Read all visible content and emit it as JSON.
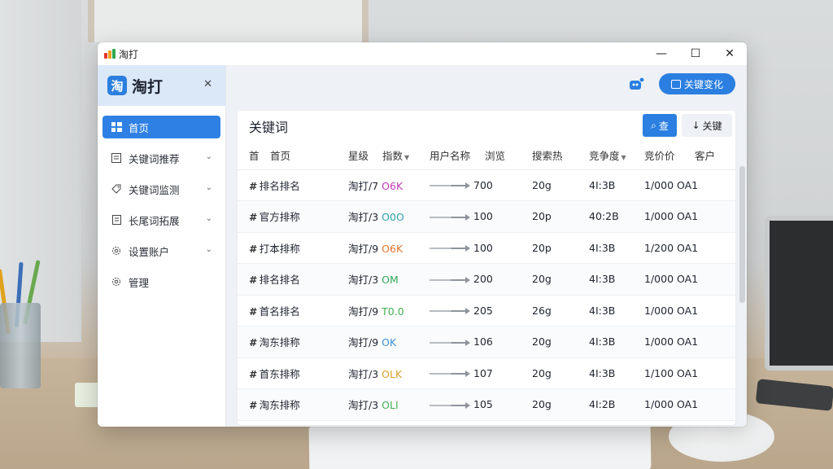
{
  "window": {
    "title": "淘打",
    "controls": {
      "minimize": "—",
      "maximize": "☐",
      "close": "✕"
    }
  },
  "sidebar": {
    "brand": {
      "logo": "淘",
      "name": "淘打",
      "close": "✕"
    },
    "items": [
      {
        "label": "首页",
        "icon": "home-icon",
        "active": true,
        "chevron": false
      },
      {
        "label": "关键词推荐",
        "icon": "list-icon",
        "active": false,
        "chevron": true
      },
      {
        "label": "关键词监测",
        "icon": "tag-icon",
        "active": false,
        "chevron": true
      },
      {
        "label": "长尾词拓展",
        "icon": "document-icon",
        "active": false,
        "chevron": true
      },
      {
        "label": "设置账户",
        "icon": "settings-icon",
        "active": false,
        "chevron": true
      },
      {
        "label": "管理",
        "icon": "gear-icon",
        "active": false,
        "chevron": false
      }
    ]
  },
  "topbar": {
    "notify_icon": "robot-icon",
    "primary_button": "关键变化"
  },
  "panel": {
    "title": "关键词",
    "search_button": "查",
    "filter_button": "关键"
  },
  "table": {
    "headers": [
      "首",
      "首页",
      "星级",
      "指数",
      "用户名称",
      "浏览",
      "搜索热",
      "竞争度",
      "竞价价",
      "客户"
    ],
    "rows": [
      {
        "keyword": "排名排名",
        "shop": "淘打/7",
        "index": "O6K",
        "index_color": "#c03ab5",
        "views": "700",
        "hot": "20g",
        "comp": "4I:3B",
        "price": "1/000 OA1"
      },
      {
        "keyword": "官方排称",
        "shop": "淘打/3",
        "index": "O0O",
        "index_color": "#2f9fb0",
        "views": "100",
        "hot": "20p",
        "comp": "40:2B",
        "price": "1/000 OA1"
      },
      {
        "keyword": "打本排称",
        "shop": "淘打/9",
        "index": "O6K",
        "index_color": "#e0772e",
        "views": "100",
        "hot": "20p",
        "comp": "4I:3B",
        "price": "1/200 OA1"
      },
      {
        "keyword": "排名排名",
        "shop": "淘打/3",
        "index": "OM",
        "index_color": "#2fa85a",
        "views": "200",
        "hot": "20g",
        "comp": "4I:3B",
        "price": "1/000 OA1"
      },
      {
        "keyword": "首名排名",
        "shop": "淘打/9",
        "index": "T0.0",
        "index_color": "#43b04f",
        "views": "205",
        "hot": "26g",
        "comp": "4I:3B",
        "price": "1/000 OA1"
      },
      {
        "keyword": "淘东排称",
        "shop": "淘打/9",
        "index": "OK",
        "index_color": "#3a8fd6",
        "views": "106",
        "hot": "20g",
        "comp": "4I:3B",
        "price": "1/000 OA1"
      },
      {
        "keyword": "首东排称",
        "shop": "淘打/3",
        "index": "OLK",
        "index_color": "#d9a02a",
        "views": "107",
        "hot": "20g",
        "comp": "4I:3B",
        "price": "1/100 OA1"
      },
      {
        "keyword": "淘东排称",
        "shop": "淘打/3",
        "index": "OLI",
        "index_color": "#43b04f",
        "views": "105",
        "hot": "20g",
        "comp": "4I:2B",
        "price": "1/000 OA1"
      }
    ]
  },
  "colors": {
    "accent": "#2b7fe0",
    "sidebar_active": "#2f80e4",
    "brand_bg": "#dbe8f7"
  }
}
